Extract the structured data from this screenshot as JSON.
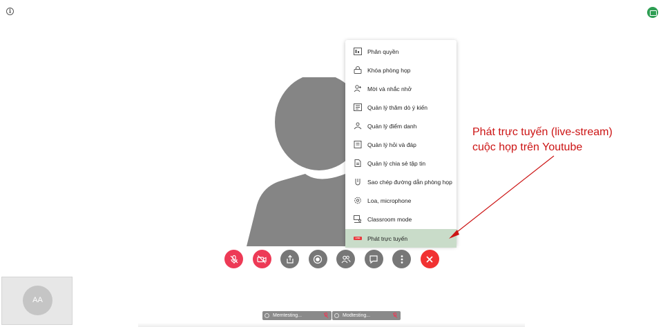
{
  "header": {
    "info_icon": "info-icon",
    "status_icon": "screen-share-status-icon"
  },
  "menu": {
    "items": [
      {
        "label": "Phân quyền",
        "icon": "permission-icon"
      },
      {
        "label": "Khóa phòng họp",
        "icon": "lock-icon"
      },
      {
        "label": "Mời và nhắc nhở",
        "icon": "add-user-icon"
      },
      {
        "label": "Quản lý thăm dò ý kiến",
        "icon": "poll-icon"
      },
      {
        "label": "Quản lý điểm danh",
        "icon": "attendance-icon"
      },
      {
        "label": "Quản lý hỏi và đáp",
        "icon": "qa-icon"
      },
      {
        "label": "Quản lý chia sẻ tập tin",
        "icon": "file-share-icon"
      },
      {
        "label": "Sao chép đường dẫn phòng họp",
        "icon": "link-icon"
      },
      {
        "label": "Loa, microphone",
        "icon": "settings-icon"
      },
      {
        "label": "Classroom mode",
        "icon": "classroom-icon"
      },
      {
        "label": "Phát trực tuyến",
        "icon": "live-icon",
        "badge": "LIVE"
      }
    ],
    "active_index": 10
  },
  "annotation": {
    "line1": "Phát trực tuyến (live-stream)",
    "line2": "cuộc họp trên Youtube",
    "color": "#cc1414"
  },
  "toolbar": {
    "buttons": [
      {
        "name": "mic-off-button",
        "icon": "microphone-off-icon"
      },
      {
        "name": "camera-off-button",
        "icon": "camera-off-icon"
      },
      {
        "name": "share-screen-button",
        "icon": "share-icon"
      },
      {
        "name": "record-button",
        "icon": "record-icon"
      },
      {
        "name": "participants-button",
        "icon": "people-icon"
      },
      {
        "name": "chat-button",
        "icon": "chat-icon"
      },
      {
        "name": "more-options-button",
        "icon": "more-vertical-icon"
      },
      {
        "name": "end-call-button",
        "icon": "close-icon"
      }
    ]
  },
  "self_view": {
    "initials": "AA"
  },
  "participants": [
    {
      "name": "Memtesting..."
    },
    {
      "name": "Modtesting..."
    }
  ],
  "colors": {
    "menu_active_bg": "#c9dcc9",
    "danger": "#ed3a56",
    "end_call": "#f13232",
    "neutral_button": "#777777",
    "status_green": "#2e9e53"
  }
}
